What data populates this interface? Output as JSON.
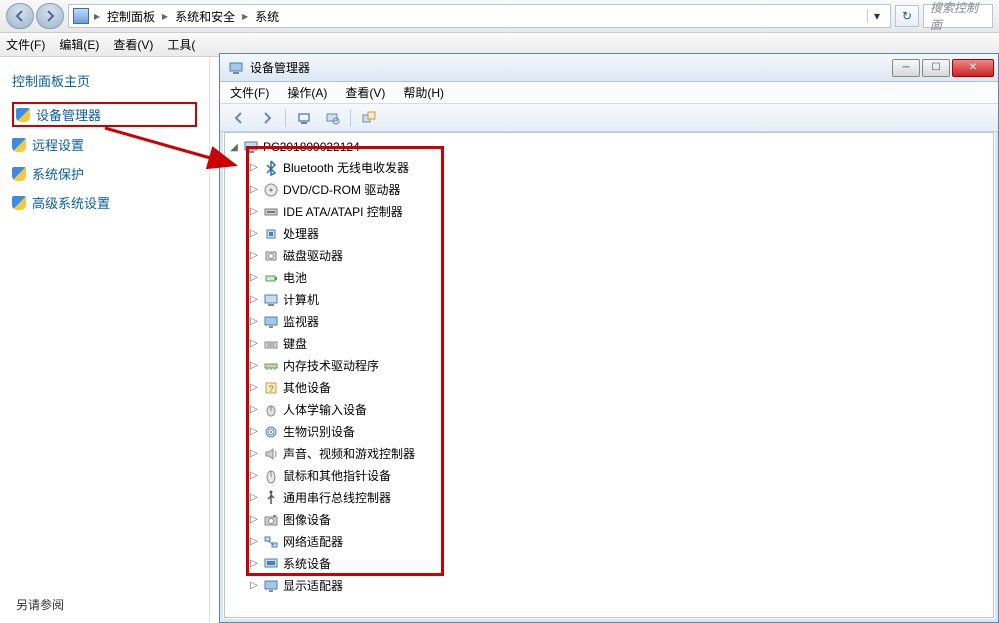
{
  "addressBar": {
    "breadcrumb": [
      "控制面板",
      "系统和安全",
      "系统"
    ],
    "searchPlaceholder": "搜索控制面"
  },
  "mainMenu": [
    "文件(F)",
    "编辑(E)",
    "查看(V)",
    "工具("
  ],
  "leftPanel": {
    "title": "控制面板主页",
    "links": [
      {
        "label": "设备管理器",
        "highlighted": true
      },
      {
        "label": "远程设置",
        "highlighted": false
      },
      {
        "label": "系统保护",
        "highlighted": false
      },
      {
        "label": "高级系统设置",
        "highlighted": false
      }
    ],
    "seeAlso": "另请参阅"
  },
  "deviceManager": {
    "title": "设备管理器",
    "menu": [
      "文件(F)",
      "操作(A)",
      "查看(V)",
      "帮助(H)"
    ],
    "rootNode": "PC201809022124",
    "categories": [
      "Bluetooth 无线电收发器",
      "DVD/CD-ROM 驱动器",
      "IDE ATA/ATAPI 控制器",
      "处理器",
      "磁盘驱动器",
      "电池",
      "计算机",
      "监视器",
      "键盘",
      "内存技术驱动程序",
      "其他设备",
      "人体学输入设备",
      "生物识别设备",
      "声音、视频和游戏控制器",
      "鼠标和其他指针设备",
      "通用串行总线控制器",
      "图像设备",
      "网络适配器",
      "系统设备",
      "显示适配器"
    ],
    "icons": [
      "bluetooth",
      "disc",
      "ide",
      "cpu",
      "disk",
      "battery",
      "computer",
      "monitor",
      "keyboard",
      "memory",
      "other",
      "hid",
      "biometric",
      "audio",
      "mouse",
      "usb",
      "camera",
      "network",
      "system",
      "display"
    ]
  }
}
